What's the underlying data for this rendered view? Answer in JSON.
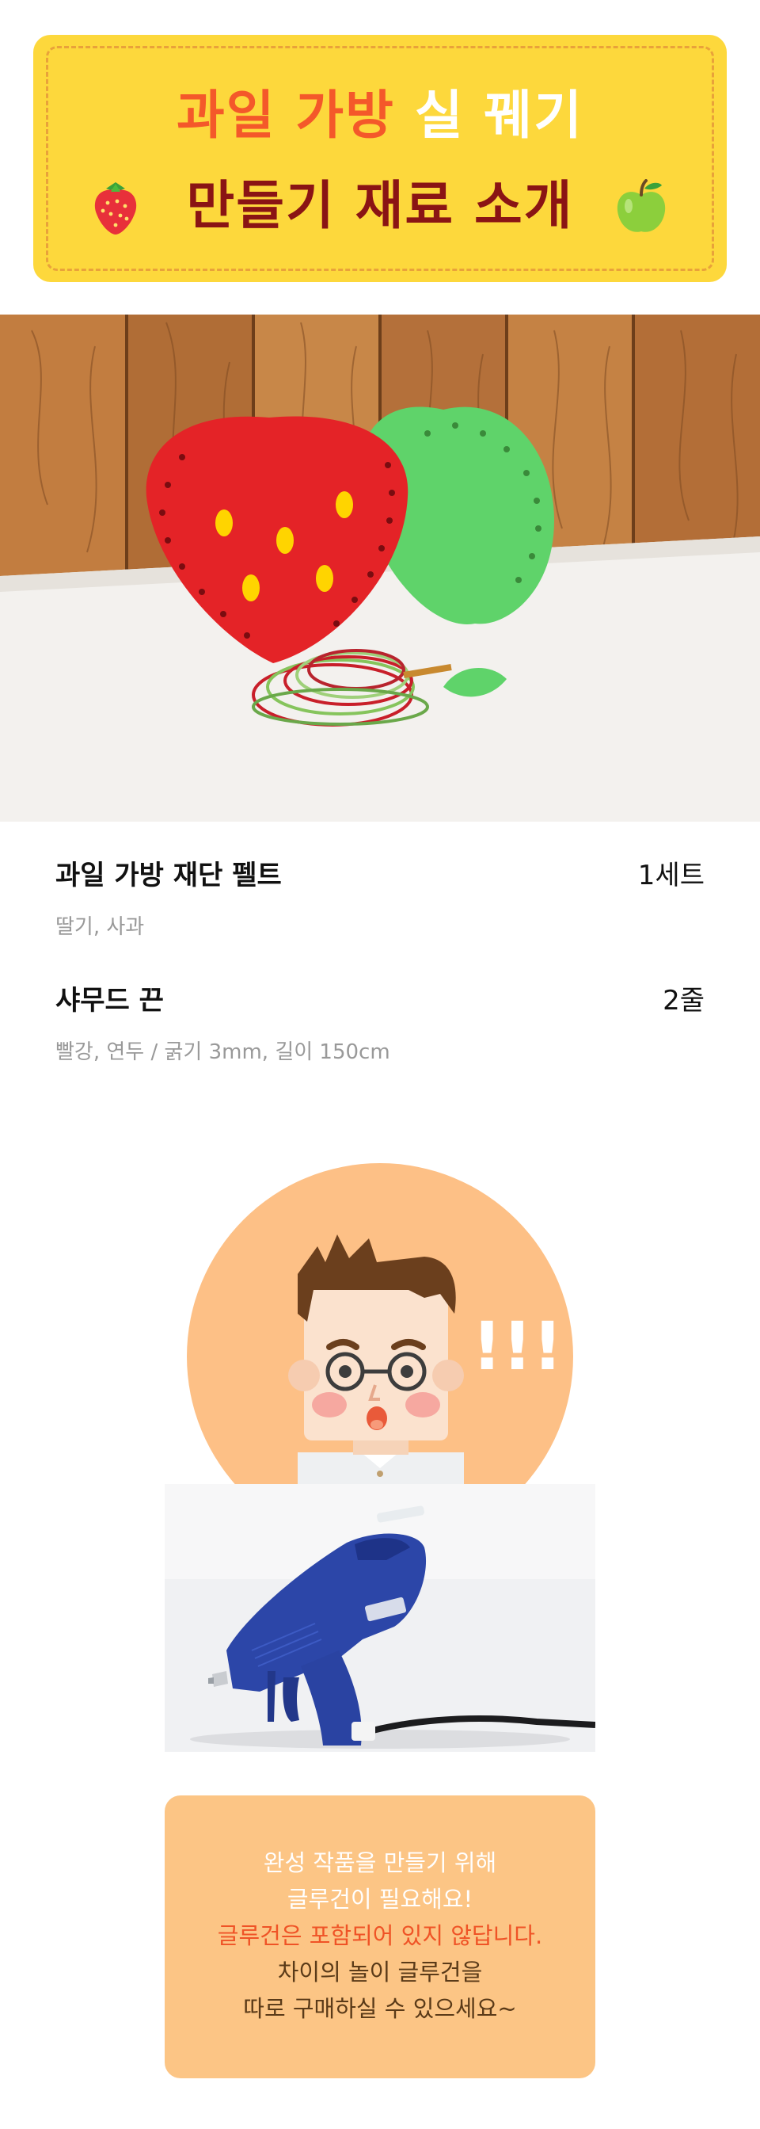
{
  "banner": {
    "title_part1": "과일 가방",
    "title_part2": "실 꿰기",
    "subtitle": "만들기 재료 소개",
    "left_icon": "strawberry-icon",
    "right_icon": "apple-icon"
  },
  "photos": {
    "materials": "felt-strawberry-apple-with-cords-photo",
    "glue_gun": "blue-glue-gun-photo",
    "character": "surprised-man-character-illustration"
  },
  "items": [
    {
      "name": "과일 가방 재단 펠트",
      "qty": "1세트",
      "desc": "딸기, 사과"
    },
    {
      "name": "샤무드 끈",
      "qty": "2줄",
      "desc": "빨강,  연두 / 굵기 3mm, 길이 150cm"
    }
  ],
  "character": {
    "exclaim": "!!!"
  },
  "notice": {
    "lines": [
      "완성 작품을 만들기 위해",
      "글루건이 필요해요!",
      "글루건은 포함되어 있지 않답니다.",
      "차이의 놀이 글루건을",
      "따로 구매하실 수 있으세요~"
    ]
  },
  "colors": {
    "banner_bg": "#fdd83c",
    "title_orange": "#f4582a",
    "subtitle_maroon": "#8a1414",
    "notice_bg": "#fcc585",
    "notice_accent": "#ef5326",
    "character_circle": "#fdc086"
  }
}
